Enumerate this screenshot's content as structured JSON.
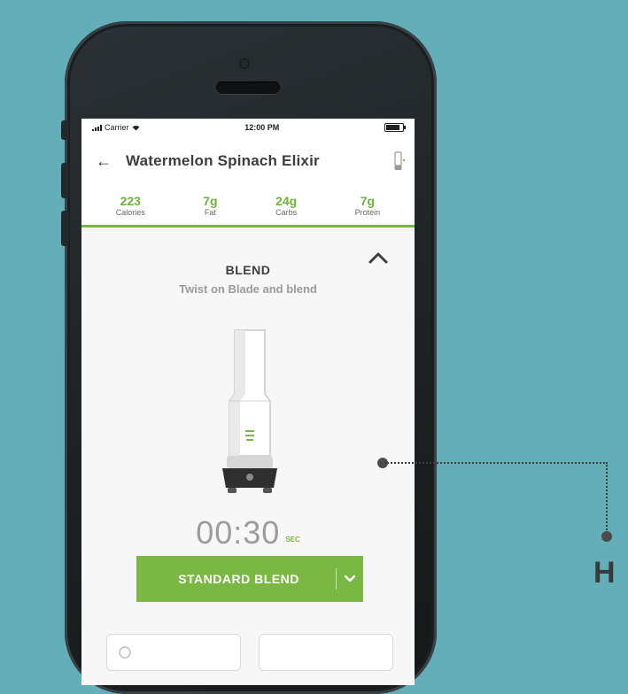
{
  "status_bar": {
    "carrier": "Carrier",
    "time": "12:00 PM"
  },
  "header": {
    "title": "Watermelon Spinach Elixir",
    "back_icon": "back-arrow-icon",
    "device_icon": "blender-bottle-icon"
  },
  "nutrition": [
    {
      "value": "223",
      "label": "Calories"
    },
    {
      "value": "7g",
      "label": "Fat"
    },
    {
      "value": "24g",
      "label": "Carbs"
    },
    {
      "value": "7g",
      "label": "Protein"
    }
  ],
  "step": {
    "title": "BLEND",
    "subtitle": "Twist on Blade and blend",
    "timer": "00:30",
    "timer_unit": "SEC",
    "button_label": "STANDARD BLEND"
  },
  "annotation": {
    "label": "H"
  },
  "colors": {
    "background": "#63aeb8",
    "accent": "#7ab743"
  }
}
